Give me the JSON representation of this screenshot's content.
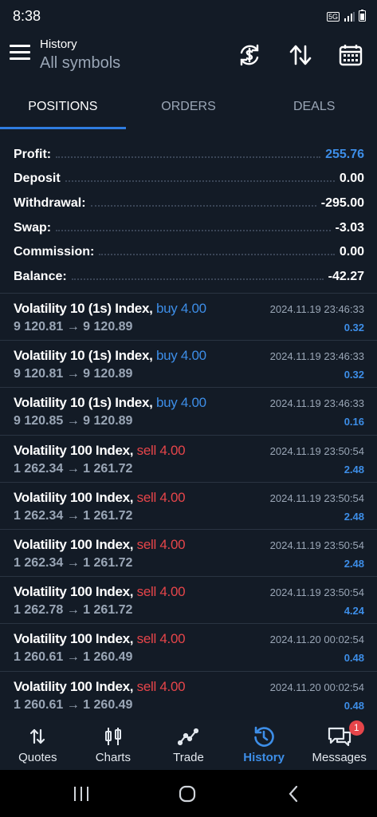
{
  "status": {
    "time": "8:38",
    "network": "5G"
  },
  "header": {
    "title": "History",
    "subtitle": "All symbols"
  },
  "tabs": [
    {
      "label": "POSITIONS",
      "active": true
    },
    {
      "label": "ORDERS",
      "active": false
    },
    {
      "label": "DEALS",
      "active": false
    }
  ],
  "summary": [
    {
      "label": "Profit:",
      "value": "255.76",
      "accent": true
    },
    {
      "label": "Deposit",
      "value": "0.00",
      "accent": false
    },
    {
      "label": "Withdrawal:",
      "value": "-295.00",
      "accent": false
    },
    {
      "label": "Swap:",
      "value": "-3.03",
      "accent": false
    },
    {
      "label": "Commission:",
      "value": "0.00",
      "accent": false
    },
    {
      "label": "Balance:",
      "value": "-42.27",
      "accent": false
    }
  ],
  "deals": [
    {
      "symbol": "Volatility 10 (1s) Index,",
      "direction": "buy 4.00",
      "type": "buy",
      "prices": "9 120.81 → 9 120.89",
      "time": "2024.11.19 23:46:33",
      "profit": "0.32"
    },
    {
      "symbol": "Volatility 10 (1s) Index,",
      "direction": "buy 4.00",
      "type": "buy",
      "prices": "9 120.81 → 9 120.89",
      "time": "2024.11.19 23:46:33",
      "profit": "0.32"
    },
    {
      "symbol": "Volatility 10 (1s) Index,",
      "direction": "buy 4.00",
      "type": "buy",
      "prices": "9 120.85 → 9 120.89",
      "time": "2024.11.19 23:46:33",
      "profit": "0.16"
    },
    {
      "symbol": "Volatility 100 Index,",
      "direction": "sell 4.00",
      "type": "sell",
      "prices": "1 262.34 → 1 261.72",
      "time": "2024.11.19 23:50:54",
      "profit": "2.48"
    },
    {
      "symbol": "Volatility 100 Index,",
      "direction": "sell 4.00",
      "type": "sell",
      "prices": "1 262.34 → 1 261.72",
      "time": "2024.11.19 23:50:54",
      "profit": "2.48"
    },
    {
      "symbol": "Volatility 100 Index,",
      "direction": "sell 4.00",
      "type": "sell",
      "prices": "1 262.34 → 1 261.72",
      "time": "2024.11.19 23:50:54",
      "profit": "2.48"
    },
    {
      "symbol": "Volatility 100 Index,",
      "direction": "sell 4.00",
      "type": "sell",
      "prices": "1 262.78 → 1 261.72",
      "time": "2024.11.19 23:50:54",
      "profit": "4.24"
    },
    {
      "symbol": "Volatility 100 Index,",
      "direction": "sell 4.00",
      "type": "sell",
      "prices": "1 260.61 → 1 260.49",
      "time": "2024.11.20 00:02:54",
      "profit": "0.48"
    },
    {
      "symbol": "Volatility 100 Index,",
      "direction": "sell 4.00",
      "type": "sell",
      "prices": "1 260.61 → 1 260.49",
      "time": "2024.11.20 00:02:54",
      "profit": "0.48"
    }
  ],
  "bottom_nav": [
    {
      "label": "Quotes",
      "icon": "quotes-icon",
      "active": false
    },
    {
      "label": "Charts",
      "icon": "charts-icon",
      "active": false
    },
    {
      "label": "Trade",
      "icon": "trade-icon",
      "active": false
    },
    {
      "label": "History",
      "icon": "history-icon",
      "active": true
    },
    {
      "label": "Messages",
      "icon": "messages-icon",
      "active": false,
      "badge": "1"
    }
  ],
  "colors": {
    "background": "#131b26",
    "accent": "#3d8ee8",
    "sell": "#e6454a",
    "muted": "#9aa6b6"
  }
}
